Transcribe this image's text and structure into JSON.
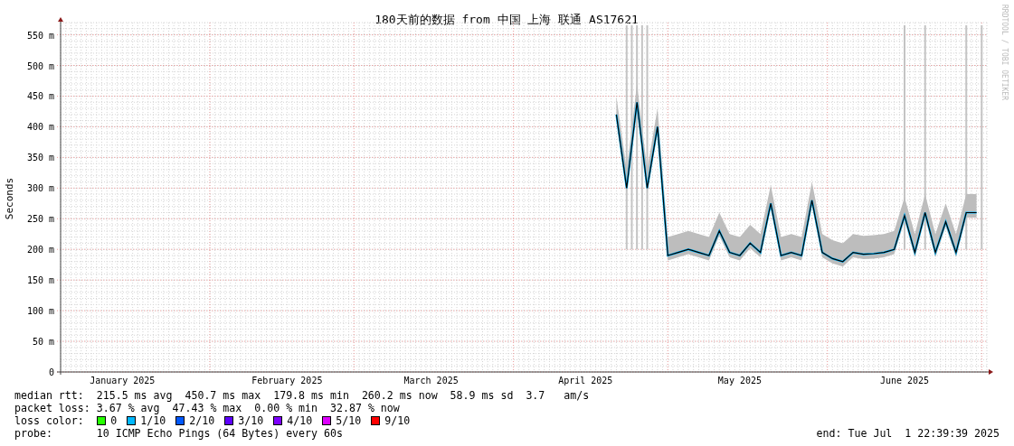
{
  "graph": {
    "title": "180天前的数据 from 中国 上海 联通 AS17621",
    "watermark": "RRDTOOL / TOBI OETIKER",
    "chart_data": {
      "type": "line",
      "grid": true,
      "ylabel": "Seconds",
      "ylim": [
        0,
        570
      ],
      "yticks": [
        {
          "value": 0,
          "label": "0"
        },
        {
          "value": 50,
          "label": "50 m"
        },
        {
          "value": 100,
          "label": "100 m"
        },
        {
          "value": 150,
          "label": "150 m"
        },
        {
          "value": 200,
          "label": "200 m"
        },
        {
          "value": 250,
          "label": "250 m"
        },
        {
          "value": 300,
          "label": "300 m"
        },
        {
          "value": 350,
          "label": "350 m"
        },
        {
          "value": 400,
          "label": "400 m"
        },
        {
          "value": 450,
          "label": "450 m"
        },
        {
          "value": 500,
          "label": "500 m"
        },
        {
          "value": 550,
          "label": "550 m"
        }
      ],
      "categories": [
        null,
        null,
        null,
        null,
        null,
        null,
        "January 2025",
        null,
        null,
        null,
        null,
        null,
        null,
        null,
        null,
        null,
        null,
        null,
        null,
        null,
        null,
        null,
        "February 2025",
        null,
        null,
        null,
        null,
        null,
        null,
        null,
        null,
        null,
        null,
        null,
        null,
        null,
        "March 2025",
        null,
        null,
        null,
        null,
        null,
        null,
        null,
        null,
        null,
        null,
        null,
        null,
        null,
        null,
        "April 2025",
        null,
        null,
        null,
        null,
        null,
        null,
        null,
        null,
        null,
        null,
        null,
        null,
        null,
        null,
        "May 2025",
        null,
        null,
        null,
        null,
        null,
        null,
        null,
        null,
        null,
        null,
        null,
        null,
        null,
        null,
        null,
        "June 2025",
        null,
        null,
        null,
        null,
        null,
        null,
        null
      ],
      "series": [
        {
          "color": "#000000",
          "values": [
            null,
            null,
            null,
            null,
            null,
            null,
            null,
            null,
            null,
            null,
            null,
            null,
            null,
            null,
            null,
            null,
            null,
            null,
            null,
            null,
            null,
            null,
            null,
            null,
            null,
            null,
            null,
            null,
            null,
            null,
            null,
            null,
            null,
            null,
            null,
            null,
            null,
            null,
            null,
            null,
            null,
            null,
            null,
            null,
            null,
            null,
            null,
            null,
            null,
            null,
            null,
            null,
            null,
            null,
            420,
            300,
            440,
            300,
            400,
            190,
            195,
            200,
            195,
            190,
            230,
            195,
            190,
            210,
            195,
            275,
            190,
            195,
            190,
            280,
            195,
            185,
            180,
            195,
            192,
            193,
            195,
            200,
            255,
            195,
            260,
            195,
            245,
            195,
            260,
            260
          ]
        }
      ]
    }
  },
  "stats": [
    {
      "label": "median rtt:",
      "items": [
        "215.5 ms avg",
        "450.7 ms max",
        "179.8 ms min",
        "260.2 ms now",
        "58.9 ms sd",
        "3.7   am/s"
      ]
    },
    {
      "label": "packet loss:",
      "items": [
        "3.67 % avg",
        "47.43 % max",
        "0.00 % min",
        "32.87 % now"
      ]
    }
  ],
  "loss_color": {
    "label": "loss color:",
    "items": [
      {
        "label": "0",
        "color": "#26ff00"
      },
      {
        "label": "1/10",
        "color": "#00b8ff"
      },
      {
        "label": "2/10",
        "color": "#0059ff"
      },
      {
        "label": "3/10",
        "color": "#5e00ff"
      },
      {
        "label": "4/10",
        "color": "#7e00ff"
      },
      {
        "label": "5/10",
        "color": "#dd00ff"
      },
      {
        "label": "9/10",
        "color": "#ff0000"
      }
    ]
  },
  "probe": {
    "label": "probe:",
    "text": "10 ICMP Echo Pings (64 Bytes) every 60s"
  },
  "end": "end: Tue Jul  1 22:39:39 2025"
}
